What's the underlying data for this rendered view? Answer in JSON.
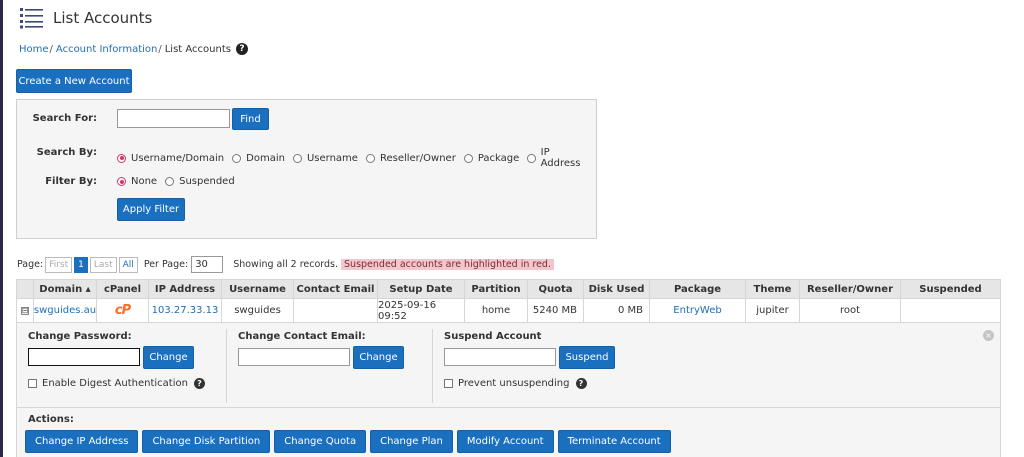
{
  "page": {
    "title": "List Accounts",
    "icon": "list-accounts-icon"
  },
  "breadcrumb": {
    "items": [
      "Home",
      "Account Information",
      "List Accounts"
    ],
    "sep": "/",
    "help": "?"
  },
  "create_button": "Create a New Account",
  "search": {
    "search_for_label": "Search For:",
    "search_value": "",
    "find_label": "Find",
    "search_by_label": "Search By:",
    "search_by_options": [
      "Username/Domain",
      "Domain",
      "Username",
      "Reseller/Owner",
      "Package",
      "IP Address"
    ],
    "filter_by_label": "Filter By:",
    "filter_by_options": [
      "None",
      "Suspended"
    ],
    "apply_label": "Apply Filter"
  },
  "pager": {
    "page_label": "Page:",
    "first": "First",
    "current": "1",
    "last": "Last",
    "all": "All",
    "per_page_label": "Per Page:",
    "per_page_value": "30",
    "records_text": "Showing all 2 records.",
    "suspended_note": "Suspended accounts are highlighted in red."
  },
  "table": {
    "columns": [
      "",
      "Domain ▴",
      "cPanel",
      "IP Address",
      "Username",
      "Contact Email",
      "Setup Date",
      "Partition",
      "Quota",
      "Disk Used",
      "Package",
      "Theme",
      "Reseller/Owner",
      "Suspended"
    ],
    "row": {
      "expander": "⊟",
      "domain": "swguides.au",
      "cpanel": "cP",
      "ip": "103.27.33.13",
      "username": "swguides",
      "contact_email": "",
      "setup_date": "2025-09-16 09:52",
      "partition": "home",
      "quota": "5240 MB",
      "disk_used": "0 MB",
      "package": "EntryWeb",
      "theme": "jupiter",
      "owner": "root",
      "suspended": ""
    }
  },
  "detail": {
    "change_password_label": "Change Password:",
    "change_password_value": "",
    "change_button": "Change",
    "digest_label": "Enable Digest Authentication",
    "contact_email_label": "Change Contact Email:",
    "contact_email_value": "",
    "contact_change_button": "Change",
    "suspend_label": "Suspend Account",
    "suspend_value": "",
    "suspend_button": "Suspend",
    "prevent_label": "Prevent unsuspending",
    "help": "?",
    "close": "×",
    "actions_label": "Actions:",
    "actions": [
      "Change IP Address",
      "Change Disk Partition",
      "Change Quota",
      "Change Plan",
      "Modify Account",
      "Terminate Account"
    ]
  },
  "colors": {
    "primary": "#1a6fbf",
    "link": "#1f6fb5",
    "radio_selected": "#d6336c",
    "suspended_highlight": "#f3c6cb",
    "cpanel_orange": "#ff6c2c"
  }
}
